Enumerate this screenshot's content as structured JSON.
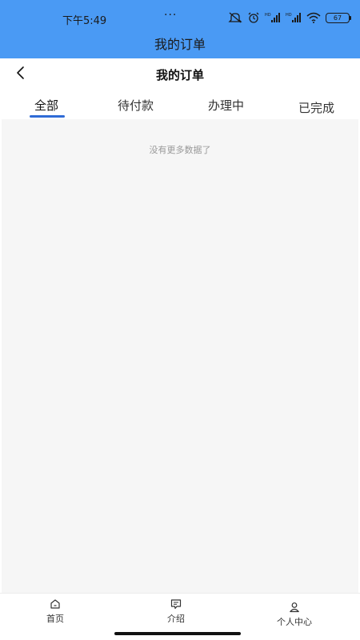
{
  "status_bar": {
    "time": "下午5:49",
    "dots": "···",
    "battery": "67",
    "icons": [
      "mute-icon",
      "alarm-icon",
      "hd-signal-icon",
      "hd-signal-icon",
      "wifi-icon",
      "battery-icon"
    ]
  },
  "header": {
    "title": "我的订单"
  },
  "nav": {
    "title": "我的订单",
    "back_icon": "chevron-left-icon"
  },
  "tabs": [
    {
      "label": "全部",
      "active": true
    },
    {
      "label": "待付款",
      "active": false
    },
    {
      "label": "办理中",
      "active": false
    },
    {
      "label": "已完成",
      "active": false
    }
  ],
  "content": {
    "empty_text": "没有更多数据了"
  },
  "bottom_nav": [
    {
      "label": "首页",
      "icon": "home-icon"
    },
    {
      "label": "介绍",
      "icon": "message-icon"
    },
    {
      "label": "个人中心",
      "icon": "user-icon"
    }
  ],
  "colors": {
    "header_bg": "#4a9af4",
    "tab_underline": "#2f6bd6",
    "content_bg": "#f6f6f6"
  }
}
